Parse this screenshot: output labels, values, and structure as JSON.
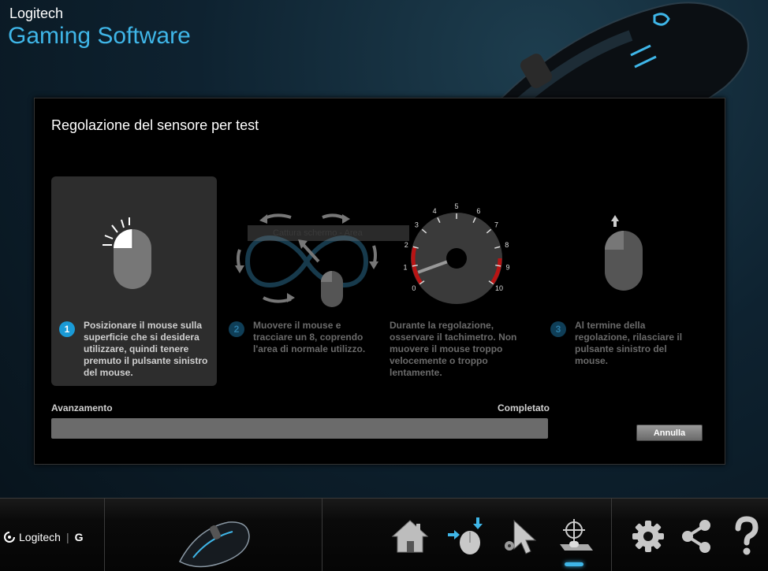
{
  "app": {
    "brand_small": "Logitech",
    "brand_big": "Gaming Software"
  },
  "dialog": {
    "title": "Regolazione del sensore per test",
    "tooltip": "Cattura schermo - Area",
    "steps": [
      {
        "number": "1",
        "text": [
          "Posizionare il mouse sulla",
          "superficie che si desidera",
          "utilizzare, quindi tenere",
          "premuto il pulsante sinistro",
          "del mouse."
        ],
        "active": true
      },
      {
        "number": "2",
        "text": [
          "Muovere il mouse e",
          "tracciare un  8, coprendo",
          "l'area di normale utilizzo."
        ],
        "active": false
      },
      {
        "number": "",
        "text": [
          "Durante la regolazione,",
          "osservare il tachimetro. Non",
          "muovere il mouse troppo",
          "velocemente o troppo",
          "lentamente."
        ],
        "active": false
      },
      {
        "number": "3",
        "text": [
          "Al termine della",
          "regolazione, rilasciare il",
          "pulsante sinistro del",
          "mouse."
        ],
        "active": false
      }
    ],
    "gauge_labels": [
      "0",
      "1",
      "2",
      "3",
      "4",
      "5",
      "6",
      "7",
      "8",
      "9",
      "10"
    ],
    "gauge_value": 0,
    "progress_label_left": "Avanzamento",
    "progress_label_right": "Completato",
    "progress_fraction": 0,
    "cancel_label": "Annulla"
  },
  "footer": {
    "logo_text": "Logitech",
    "logo_g": "G",
    "nav_icons": [
      "home-icon",
      "device-settings-icon",
      "pointer-settings-icon",
      "surface-tuning-icon",
      "gear-icon",
      "share-icon",
      "help-icon"
    ],
    "active_nav": "surface-tuning-icon"
  },
  "colors": {
    "accent": "#3fb6e8",
    "gauge_red": "#b81414",
    "panel": "#000000",
    "step_box": "#2d2d2d"
  }
}
